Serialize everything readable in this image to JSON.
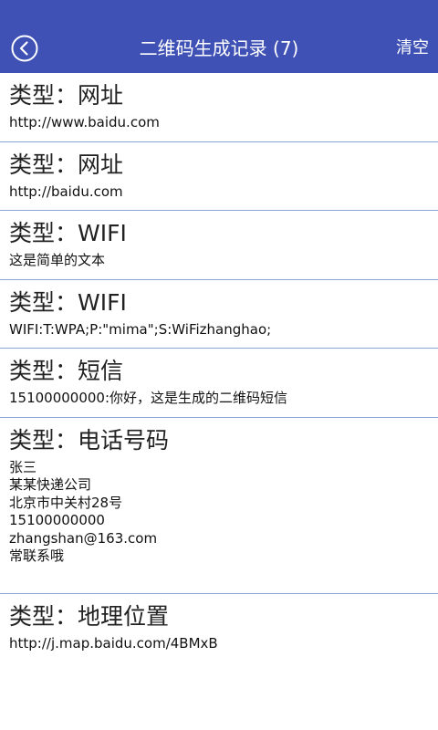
{
  "app": {
    "title": "二维码生成记录 (7)",
    "clear_label": "清空",
    "accent_color": "#3f51b5",
    "back_icon": "back-circle-icon"
  },
  "records": [
    {
      "type": "类型：网址",
      "content": "http://www.baidu.com"
    },
    {
      "type": "类型：网址",
      "content": "http://baidu.com"
    },
    {
      "type": "类型：WIFI",
      "content": "这是简单的文本"
    },
    {
      "type": "类型：WIFI",
      "content": "WIFI:T:WPA;P:\"mima\";S:WiFizhanghao;"
    },
    {
      "type": "类型：短信",
      "content": "15100000000:你好，这是生成的二维码短信"
    },
    {
      "type": "类型：电话号码",
      "content": "张三\n某某快递公司\n北京市中关村28号\n15100000000\nzhangshan@163.com\n常联系哦"
    },
    {
      "type": "类型：地理位置",
      "content": "http://j.map.baidu.com/4BMxB"
    }
  ]
}
